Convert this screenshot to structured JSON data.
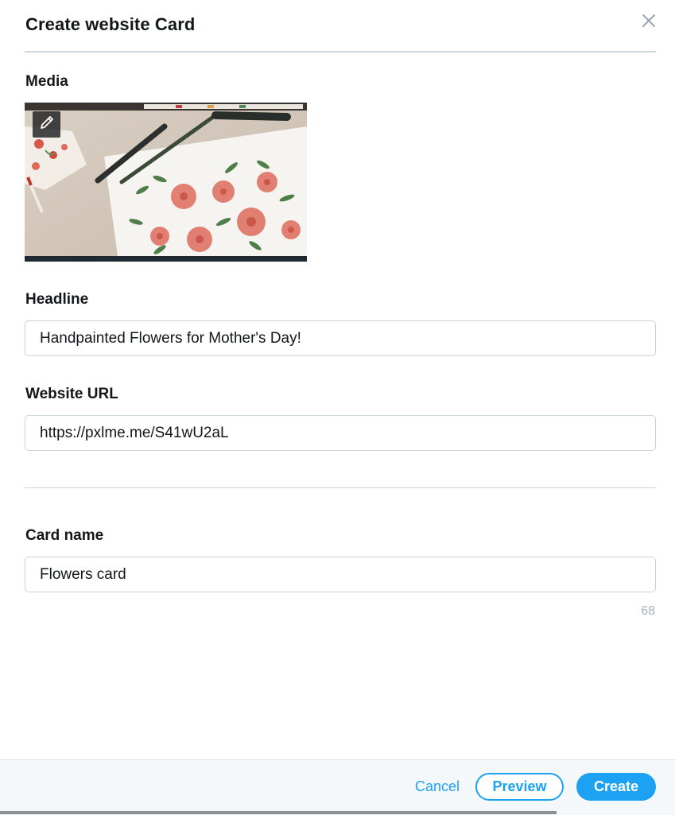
{
  "dialog": {
    "title": "Create website Card",
    "close_icon": "close-icon"
  },
  "media": {
    "label": "Media",
    "edit_icon": "pencil-icon"
  },
  "headline": {
    "label": "Headline",
    "value": "Handpainted Flowers for Mother's Day!"
  },
  "website_url": {
    "label": "Website URL",
    "value": "https://pxlme.me/S41wU2aL"
  },
  "card_name": {
    "label": "Card name",
    "value": "Flowers card",
    "remaining_chars": "68"
  },
  "footer": {
    "cancel_label": "Cancel",
    "preview_label": "Preview",
    "create_label": "Create"
  },
  "colors": {
    "accent": "#1da1f2",
    "text": "#14171a",
    "border": "#c9d3da",
    "muted": "#a5b3bd",
    "footer_bg": "#f5f8fa"
  }
}
